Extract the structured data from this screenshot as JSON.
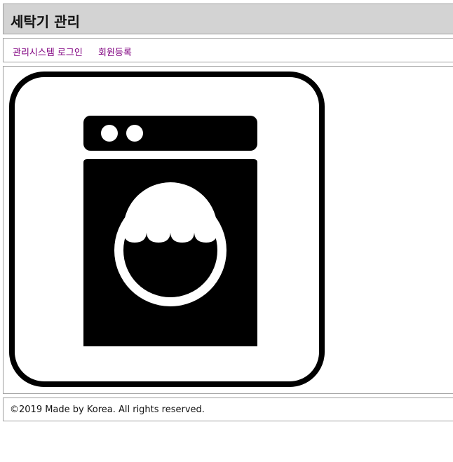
{
  "header": {
    "title": "세탁기 관리"
  },
  "nav": {
    "links": [
      {
        "label": "관리시스템 로그인"
      },
      {
        "label": "회원등록"
      }
    ]
  },
  "main": {
    "image_icon": "washing-machine-icon"
  },
  "footer": {
    "text": "©2019 Made by Korea. All rights reserved."
  },
  "colors": {
    "header_bg": "#d3d3d3",
    "link": "#800080",
    "border": "#a0a0a0"
  }
}
